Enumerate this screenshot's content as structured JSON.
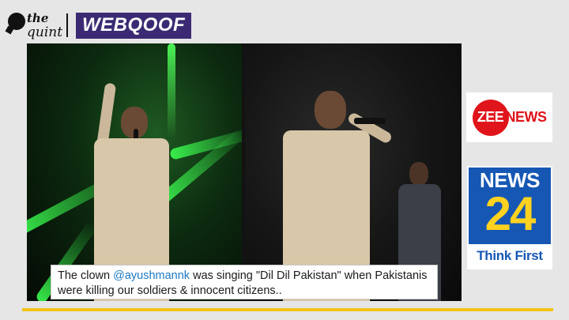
{
  "header": {
    "quint_top": "the",
    "quint_bottom": "quint",
    "webqoof": "WEBQOOF"
  },
  "tweet": {
    "prefix": "The clown ",
    "handle": "@ayushmannk",
    "middle": " was singing \"Dil Dil Pakistan\" when Pakistanis",
    "line2": "were killing our soldiers & innocent citizens.."
  },
  "logos": {
    "zee_left": "ZEE",
    "zee_right": "NEWS",
    "news24_top": "NEWS",
    "news24_num": "24",
    "news24_tag": "Think First"
  },
  "colors": {
    "webqoof_bg": "#3b2a73",
    "accent_bar": "#f0c419",
    "zee_red": "#e0141b",
    "news24_blue": "#1757b4",
    "news24_yellow": "#ffd21f",
    "tweet_handle": "#1d79c4"
  }
}
